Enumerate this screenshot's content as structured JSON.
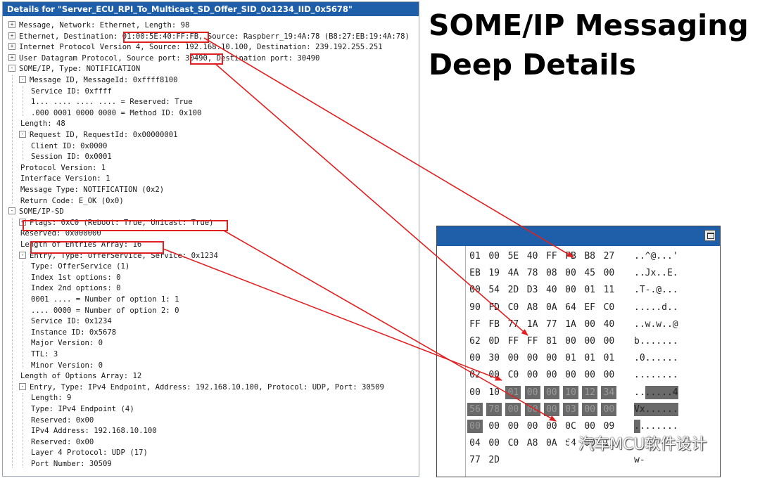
{
  "details": {
    "title": "Details for \"Server_ECU_RPI_To_Multicast_SD_Offer_SID_0x1234_IID_0x5678\"",
    "rows": [
      {
        "level": 0,
        "toggle": "+",
        "text": "Message, Network: Ethernet, Length: 98"
      },
      {
        "level": 0,
        "toggle": "+",
        "text": "Ethernet, Destination: 01:00:5E:40:FF:FB, Source: Raspberr_19:4A:78 (B8:27:EB:19:4A:78)"
      },
      {
        "level": 0,
        "toggle": "+",
        "text": "Internet Protocol Version 4, Source: 192.168.10.100, Destination: 239.192.255.251"
      },
      {
        "level": 0,
        "toggle": "+",
        "text": "User Datagram Protocol, Source port: 30490, Destination port: 30490"
      },
      {
        "level": 0,
        "toggle": "-",
        "text": "SOME/IP, Type: NOTIFICATION"
      },
      {
        "level": 1,
        "toggle": "-",
        "text": "Message ID, MessageId: 0xffff8100"
      },
      {
        "level": 2,
        "toggle": "",
        "text": "Service ID: 0xffff"
      },
      {
        "level": 2,
        "toggle": "",
        "text": "1... .... .... .... = Reserved: True"
      },
      {
        "level": 2,
        "toggle": "",
        "text": ".000 0001 0000 0000 = Method ID: 0x100"
      },
      {
        "level": 1,
        "toggle": "",
        "text": "Length: 48"
      },
      {
        "level": 1,
        "toggle": "-",
        "text": "Request ID, RequestId: 0x00000001"
      },
      {
        "level": 2,
        "toggle": "",
        "text": "Client ID: 0x0000"
      },
      {
        "level": 2,
        "toggle": "",
        "text": "Session ID: 0x0001"
      },
      {
        "level": 1,
        "toggle": "",
        "text": "Protocol Version: 1"
      },
      {
        "level": 1,
        "toggle": "",
        "text": "Interface Version: 1"
      },
      {
        "level": 1,
        "toggle": "",
        "text": "Message Type: NOTIFICATION (0x2)"
      },
      {
        "level": 1,
        "toggle": "",
        "text": "Return Code: E_OK (0x0)"
      },
      {
        "level": 0,
        "toggle": "-",
        "text": "SOME/IP-SD"
      },
      {
        "level": 1,
        "toggle": "+",
        "text": "Flags: 0xC0 (Reboot: True, Unicast: True)"
      },
      {
        "level": 1,
        "toggle": "",
        "text": "Reserved: 0x000000"
      },
      {
        "level": 1,
        "toggle": "",
        "text": "Length of Entries Array: 16"
      },
      {
        "level": 1,
        "toggle": "-",
        "text": "Entry, Type: OfferService, Service: 0x1234"
      },
      {
        "level": 2,
        "toggle": "",
        "text": "Type: OfferService (1)"
      },
      {
        "level": 2,
        "toggle": "",
        "text": "Index 1st options: 0"
      },
      {
        "level": 2,
        "toggle": "",
        "text": "Index 2nd options: 0"
      },
      {
        "level": 2,
        "toggle": "",
        "text": "0001 .... = Number of option 1: 1"
      },
      {
        "level": 2,
        "toggle": "",
        "text": ".... 0000 = Number of option 2: 0"
      },
      {
        "level": 2,
        "toggle": "",
        "text": "Service ID: 0x1234"
      },
      {
        "level": 2,
        "toggle": "",
        "text": "Instance ID: 0x5678"
      },
      {
        "level": 2,
        "toggle": "",
        "text": "Major Version: 0"
      },
      {
        "level": 2,
        "toggle": "",
        "text": "TTL: 3"
      },
      {
        "level": 2,
        "toggle": "",
        "text": "Minor Version: 0"
      },
      {
        "level": 1,
        "toggle": "",
        "text": "Length of Options Array: 12"
      },
      {
        "level": 1,
        "toggle": "-",
        "text": "Entry, Type: IPv4 Endpoint, Address: 192.168.10.100, Protocol: UDP, Port: 30509"
      },
      {
        "level": 2,
        "toggle": "",
        "text": "Length: 9"
      },
      {
        "level": 2,
        "toggle": "",
        "text": "Type: IPv4 Endpoint (4)"
      },
      {
        "level": 2,
        "toggle": "",
        "text": "Reserved: 0x00"
      },
      {
        "level": 2,
        "toggle": "",
        "text": "IPv4 Address: 192.168.10.100"
      },
      {
        "level": 2,
        "toggle": "",
        "text": "Reserved: 0x00"
      },
      {
        "level": 2,
        "toggle": "",
        "text": "Layer 4 Protocol: UDP (17)"
      },
      {
        "level": 2,
        "toggle": "",
        "text": "Port Number: 30509"
      }
    ]
  },
  "title": {
    "line1": "SOME/IP Messaging",
    "line2": "Deep Details"
  },
  "hex": {
    "rows": [
      {
        "bytes": [
          "01",
          "00",
          "5E",
          "40",
          "FF",
          "FB",
          "B8",
          "27"
        ],
        "ascii": "..^@...'"
      },
      {
        "bytes": [
          "EB",
          "19",
          "4A",
          "78",
          "08",
          "00",
          "45",
          "00"
        ],
        "ascii": "..Jx..E."
      },
      {
        "bytes": [
          "00",
          "54",
          "2D",
          "D3",
          "40",
          "00",
          "01",
          "11"
        ],
        "ascii": ".T-.@..."
      },
      {
        "bytes": [
          "90",
          "FD",
          "C0",
          "A8",
          "0A",
          "64",
          "EF",
          "C0"
        ],
        "ascii": ".....d.."
      },
      {
        "bytes": [
          "FF",
          "FB",
          "77",
          "1A",
          "77",
          "1A",
          "00",
          "40"
        ],
        "ascii": "..w.w..@"
      },
      {
        "bytes": [
          "62",
          "0D",
          "FF",
          "FF",
          "81",
          "00",
          "00",
          "00"
        ],
        "ascii": "b......."
      },
      {
        "bytes": [
          "00",
          "30",
          "00",
          "00",
          "00",
          "01",
          "01",
          "01"
        ],
        "ascii": ".0......"
      },
      {
        "bytes": [
          "02",
          "00",
          "C0",
          "00",
          "00",
          "00",
          "00",
          "00"
        ],
        "ascii": "........"
      },
      {
        "bytes": [
          "00",
          "10",
          "01",
          "00",
          "00",
          "10",
          "12",
          "34"
        ],
        "ascii": ".......4"
      },
      {
        "bytes": [
          "56",
          "78",
          "00",
          "00",
          "00",
          "03",
          "00",
          "00"
        ],
        "ascii": "Vx......"
      },
      {
        "bytes": [
          "00",
          "00",
          "00",
          "00",
          "00",
          "0C",
          "00",
          "09"
        ],
        "ascii": "........"
      },
      {
        "bytes": [
          "04",
          "00",
          "C0",
          "A8",
          "0A",
          "64",
          "00",
          "11"
        ],
        "ascii": ""
      },
      {
        "bytes": [
          "77",
          "2D"
        ],
        "ascii": "w-"
      }
    ],
    "selected_bytes": [
      [
        8,
        2
      ],
      [
        8,
        3
      ],
      [
        8,
        4
      ],
      [
        8,
        5
      ],
      [
        8,
        6
      ],
      [
        8,
        7
      ],
      [
        9,
        0
      ],
      [
        9,
        1
      ],
      [
        9,
        2
      ],
      [
        9,
        3
      ],
      [
        9,
        4
      ],
      [
        9,
        5
      ],
      [
        9,
        6
      ],
      [
        9,
        7
      ],
      [
        10,
        0
      ]
    ]
  },
  "watermark": {
    "text": "汽车MCU软件设计"
  },
  "colors": {
    "titlebar": "#1f5fa9",
    "highlight": "#e02020",
    "selected_byte": "#6a6a6a"
  }
}
